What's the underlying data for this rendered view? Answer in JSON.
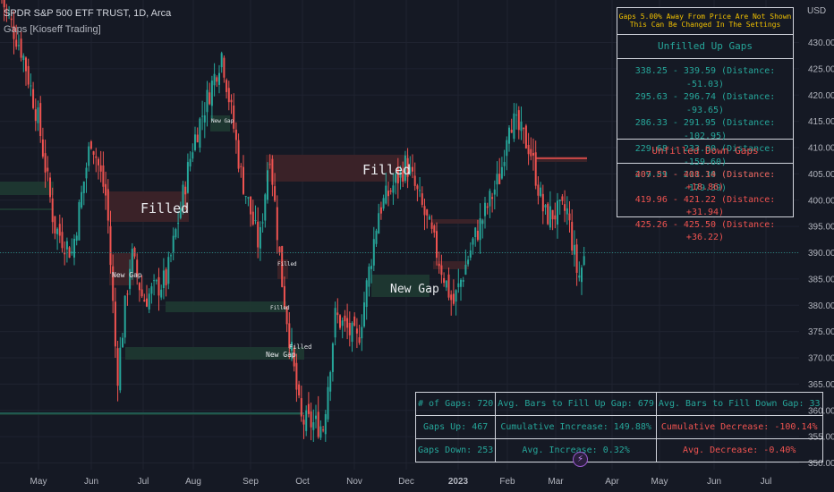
{
  "header": {
    "symbol_line": "SPDR S&P 500 ETF TRUST, 1D, Arca",
    "indicator_line": "Gaps [Kioseff Trading]"
  },
  "currency_label": "USD",
  "colors": {
    "background": "#151924",
    "up": "#26a69a",
    "down": "#ef5350",
    "gap_up_zone": "#1e3a32",
    "gap_down_zone": "#3e2329",
    "text": "#d1d4dc",
    "notice_text": "#f0c000"
  },
  "gaps_panel": {
    "notice_line1": "Gaps 5.00% Away From Price Are Not Shown",
    "notice_line2": "This Can Be Changed In The Settings",
    "up_title": "Unfilled Up Gaps",
    "up_gaps": [
      "338.25 - 339.59 (Distance: -51.03)",
      "295.63 - 296.74 (Distance: -93.65)",
      "286.33 - 291.95 (Distance: -102.95)",
      "229.68 - 233.80 (Distance: -159.60)",
      "209.89 - 211.30 (Distance: -179.39)"
    ],
    "down_title": "Unfilled Down Gaps",
    "down_gaps": [
      "407.51 - 408.14 (Distance: +18.86)",
      "419.96 - 421.22 (Distance: +31.94)",
      "425.26 - 425.50 (Distance: +36.22)"
    ]
  },
  "stats_table": {
    "row1": [
      "# of Gaps: 720",
      "Avg. Bars to Fill Up Gap: 679",
      "Avg. Bars to Fill Down Gap: 33"
    ],
    "row2": [
      "Gaps Up: 467",
      "Cumulative Increase: 149.88%",
      "Cumulative Decrease: -100.14%"
    ],
    "row3": [
      "Gaps Down: 253",
      "Avg. Increase: 0.32%",
      "Avg. Decrease: -0.40%"
    ]
  },
  "chart_data": {
    "type": "candlestick",
    "title": "SPDR S&P 500 ETF TRUST, 1D, Arca",
    "ylabel": "USD",
    "ylim": [
      348,
      435
    ],
    "y_ticks": [
      350,
      355,
      360,
      365,
      370,
      375,
      380,
      385,
      390,
      395,
      400,
      405,
      410,
      415,
      420,
      425,
      430
    ],
    "x_ticks": [
      "May",
      "Jun",
      "Jul",
      "Aug",
      "Sep",
      "Oct",
      "Nov",
      "Dec",
      "2023",
      "Feb",
      "Mar",
      "Apr",
      "May",
      "Jun",
      "Jul"
    ],
    "price_path": [
      [
        "Apr 1",
        452
      ],
      [
        "Apr 8",
        440
      ],
      [
        "Apr 22",
        428
      ],
      [
        "May 1",
        415
      ],
      [
        "May 10",
        395
      ],
      [
        "May 20",
        390
      ],
      [
        "Jun 1",
        412
      ],
      [
        "Jun 10",
        400
      ],
      [
        "Jun 16",
        366
      ],
      [
        "Jun 24",
        390
      ],
      [
        "Jul 1",
        381
      ],
      [
        "Jul 15",
        385
      ],
      [
        "Aug 1",
        411
      ],
      [
        "Aug 16",
        428
      ],
      [
        "Aug 26",
        405
      ],
      [
        "Sep 6",
        391
      ],
      [
        "Sep 12",
        410
      ],
      [
        "Sep 19",
        385
      ],
      [
        "Sep 30",
        358
      ],
      [
        "Oct 13",
        357
      ],
      [
        "Oct 20",
        378
      ],
      [
        "Nov 3",
        373
      ],
      [
        "Nov 15",
        398
      ],
      [
        "Dec 1",
        407
      ],
      [
        "Dec 14",
        395
      ],
      [
        "Dec 28",
        380
      ],
      [
        "Jan 10",
        392
      ],
      [
        "Jan 27",
        405
      ],
      [
        "Feb 2",
        416
      ],
      [
        "Feb 15",
        410
      ],
      [
        "Feb 24",
        397
      ],
      [
        "Mar 7",
        398
      ],
      [
        "Mar 13",
        385
      ],
      [
        "Mar 17",
        390
      ]
    ],
    "last_price": 389.99,
    "gap_zone_labels": [
      {
        "text": "Filled",
        "kind": "down"
      },
      {
        "text": "Filled",
        "kind": "down"
      },
      {
        "text": "New Gap",
        "kind": "up"
      },
      {
        "text": "New Gap",
        "kind": "up"
      },
      {
        "text": "New Gap",
        "kind": "up"
      },
      {
        "text": "New Gap",
        "kind": "up"
      },
      {
        "text": "Filled",
        "kind": "up"
      },
      {
        "text": "Filled",
        "kind": "up"
      },
      {
        "text": "Filled",
        "kind": "up"
      }
    ]
  }
}
